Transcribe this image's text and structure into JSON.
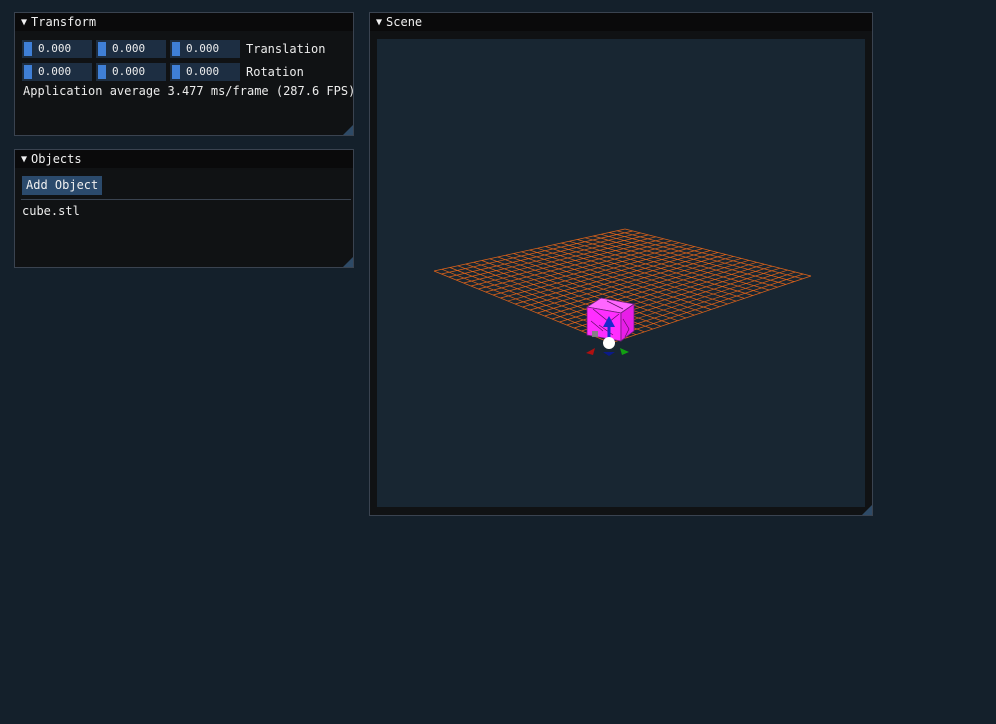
{
  "transform": {
    "title": "Transform",
    "translation": {
      "label": "Translation",
      "values": [
        "0.000",
        "0.000",
        "0.000"
      ]
    },
    "rotation": {
      "label": "Rotation",
      "values": [
        "0.000",
        "0.000",
        "0.000"
      ]
    },
    "fps_text": "Application average 3.477 ms/frame (287.6 FPS)"
  },
  "objects": {
    "title": "Objects",
    "add_button": "Add Object",
    "items": [
      "cube.stl"
    ]
  },
  "scene": {
    "title": "Scene"
  },
  "icons": {
    "collapse": "collapse-triangle-icon",
    "resize": "resize-grip-icon",
    "gizmo": "translate-gizmo-icon"
  },
  "colors": {
    "background": "#14202b",
    "window": "#101214",
    "slider_grab": "#3f7fd6",
    "button": "#2b4a6c",
    "grid": "#e0641a",
    "cube": "#ff3cff"
  }
}
